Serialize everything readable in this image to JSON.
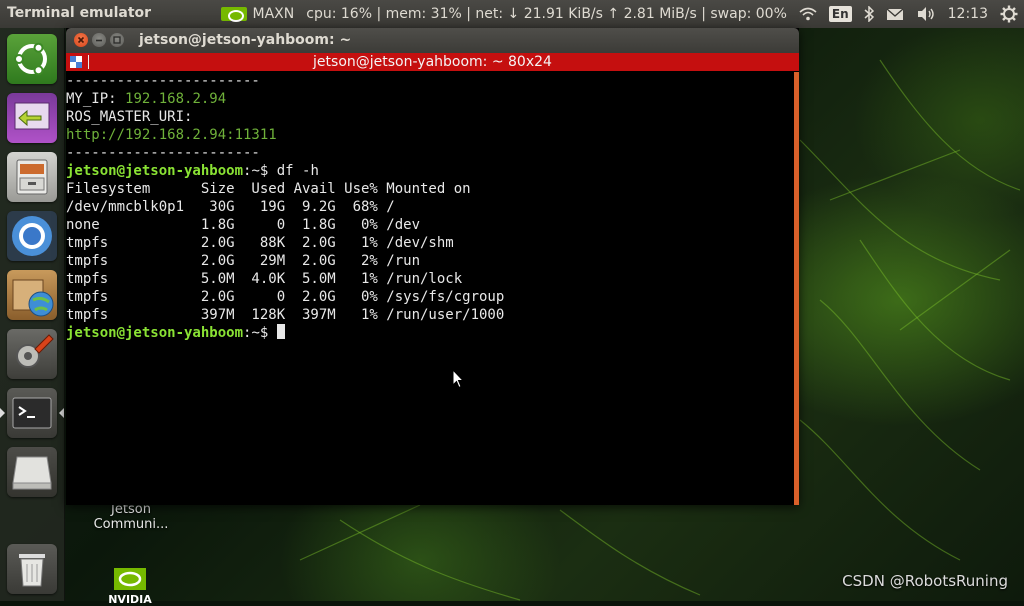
{
  "top_panel": {
    "app_title": "Terminal emulator",
    "power_mode": "MAXN",
    "stats": "cpu: 16% | mem: 31% | net: ↓ 21.91 KiB/s ↑ 2.81 MiB/s | swap: 00%",
    "keyboard_layout": "En",
    "time": "12:13"
  },
  "window": {
    "title": "jetson@jetson-yahboom: ~",
    "tab_title": "jetson@jetson-yahboom: ~ 80x24"
  },
  "terminal": {
    "separator_top": "-----------------------",
    "my_ip_label": "MY_IP: ",
    "my_ip_value": "192.168.2.94",
    "ros_master_label": "ROS_MASTER_URI:",
    "ros_master_value": "http://192.168.2.94:11311",
    "separator_bottom": "-----------------------",
    "prompt_user": "jetson@jetson-yahboom",
    "prompt_path": ":~$ ",
    "command": "df -h",
    "df_header": "Filesystem      Size  Used Avail Use% Mounted on",
    "df_rows": [
      "/dev/mmcblk0p1   30G   19G  9.2G  68% /",
      "none            1.8G     0  1.8G   0% /dev",
      "tmpfs           2.0G   88K  2.0G   1% /dev/shm",
      "tmpfs           2.0G   29M  2.0G   2% /run",
      "tmpfs           5.0M  4.0K  5.0M   1% /run/lock",
      "tmpfs           2.0G     0  2.0G   0% /sys/fs/cgroup",
      "tmpfs           397M  128K  397M   1% /run/user/1000"
    ],
    "final_prompt_path": ":~$ "
  },
  "desktop_icons": {
    "jetson_community_line1": "Jetson",
    "jetson_community_line2": "Communi...",
    "nvidia_label": "NVIDIA"
  },
  "watermark": "CSDN @RobotsRuning",
  "colors": {
    "terminal_tab": "#c50f0f",
    "prompt_green": "#8ae234",
    "value_green": "#6fb13a",
    "nvidia_green": "#76b900"
  }
}
